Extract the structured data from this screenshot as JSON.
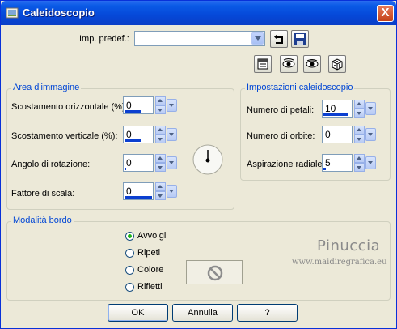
{
  "window": {
    "title": "Caleidoscopio",
    "close_label": "X"
  },
  "preset": {
    "label": "Imp. predef.:",
    "value": ""
  },
  "toolbar": {
    "icons": [
      "reset-icon",
      "preview-eye-icon",
      "proof-eye-icon",
      "randomize-dice-icon"
    ]
  },
  "image_area": {
    "title": "Area d'immagine",
    "fields": [
      {
        "label": "Scostamento orizzontale (%):",
        "value": "0"
      },
      {
        "label": "Scostamento verticale (%):",
        "value": "0"
      },
      {
        "label": "Angolo di rotazione:",
        "value": "0"
      },
      {
        "label": "Fattore di scala:",
        "value": "0"
      }
    ]
  },
  "kaleido_settings": {
    "title": "Impostazioni caleidoscopio",
    "fields": [
      {
        "label": "Numero di petali:",
        "value": "10"
      },
      {
        "label": "Numero di orbite:",
        "value": "0"
      },
      {
        "label": "Aspirazione radiale:",
        "value": "5"
      }
    ]
  },
  "border_mode": {
    "title": "Modalità bordo",
    "options": [
      "Avvolgi",
      "Ripeti",
      "Colore",
      "Rifletti"
    ],
    "selected": "Avvolgi"
  },
  "watermark": {
    "name": "Pinuccia",
    "url": "www.maidiregrafica.eu"
  },
  "buttons": {
    "ok": "OK",
    "cancel": "Annulla",
    "help": "?"
  }
}
